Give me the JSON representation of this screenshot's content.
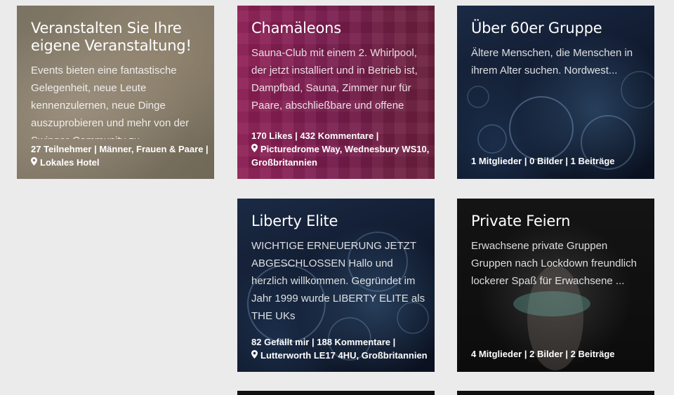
{
  "cards": [
    {
      "title": "Veranstalten Sie Ihre eigene Veranstaltung!",
      "description": "Events bieten eine fantastische Gelegenheit, neue Leute kennenzulernen, neue Dinge auszuprobieren und mehr von der Swinger-Community zu",
      "meta1": "27 Teilnehmer | Männer, Frauen & Paare |",
      "meta2": "Lokales Hotel"
    },
    {
      "title": "Chamäleons",
      "description": "Sauna-Club mit einem 2. Whirlpool, der jetzt installiert und in Betrieb ist, Dampfbad, Sauna, Zimmer nur für Paare, abschließbare und offene",
      "meta1": "170 Likes | 432 Kommentare |",
      "meta2": "Picturedrome Way, Wednesbury WS10, Großbritannien"
    },
    {
      "title": "Über 60er Gruppe",
      "description": "Ältere Menschen, die Menschen in ihrem Alter suchen. Nordwest...",
      "meta1": "1 Mitglieder | 0 Bilder | 1 Beiträge"
    },
    {
      "title": "Liberty Elite",
      "description": "WICHTIGE ERNEUERUNG JETZT ABGESCHLOSSEN Hallo und herzlich willkommen. Gegründet im Jahr 1999 wurde LIBERTY ELITE als THE UKs",
      "meta1": "82 Gefällt mir | 188 Kommentare |",
      "meta2": "Lutterworth LE17 4HU, Großbritannien"
    },
    {
      "title": "Private Feiern",
      "description": "Erwachsene private Gruppen Gruppen nach Lockdown freundlich lockerer Spaß für Erwachsene ...",
      "meta1": "4 Mitglieder | 2 Bilder | 2 Beiträge"
    }
  ],
  "icons": {
    "location": "map-pin-icon"
  },
  "colors": {
    "page_bg": "#ebebeb",
    "pink_card": "#7a1c4f",
    "dark_card": "#0d1628"
  }
}
